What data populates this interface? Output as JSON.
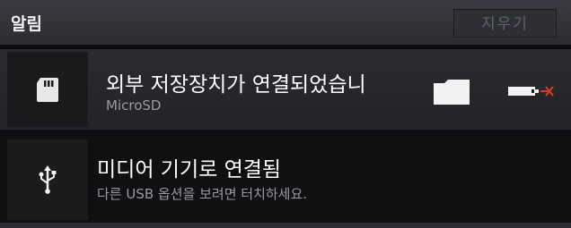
{
  "header": {
    "title": "알림",
    "clear_label": "지우기"
  },
  "notifications": [
    {
      "title": "외부 저장장치가 연결되었습니",
      "subtitle": "MicroSD",
      "icon": "sd-card-icon",
      "actions": [
        "folder-icon",
        "unmount-icon"
      ]
    },
    {
      "title": "미디어 기기로 연결됨",
      "subtitle": "다른 USB 옵션을 보려면 터치하세요.",
      "icon": "usb-icon"
    }
  ],
  "colors": {
    "header_bg": "#2b2c31",
    "row_bg": "#222327",
    "title_text": "#ffffff",
    "subtitle_text": "#9a9a9f",
    "eject_accent": "#d23a2a"
  }
}
